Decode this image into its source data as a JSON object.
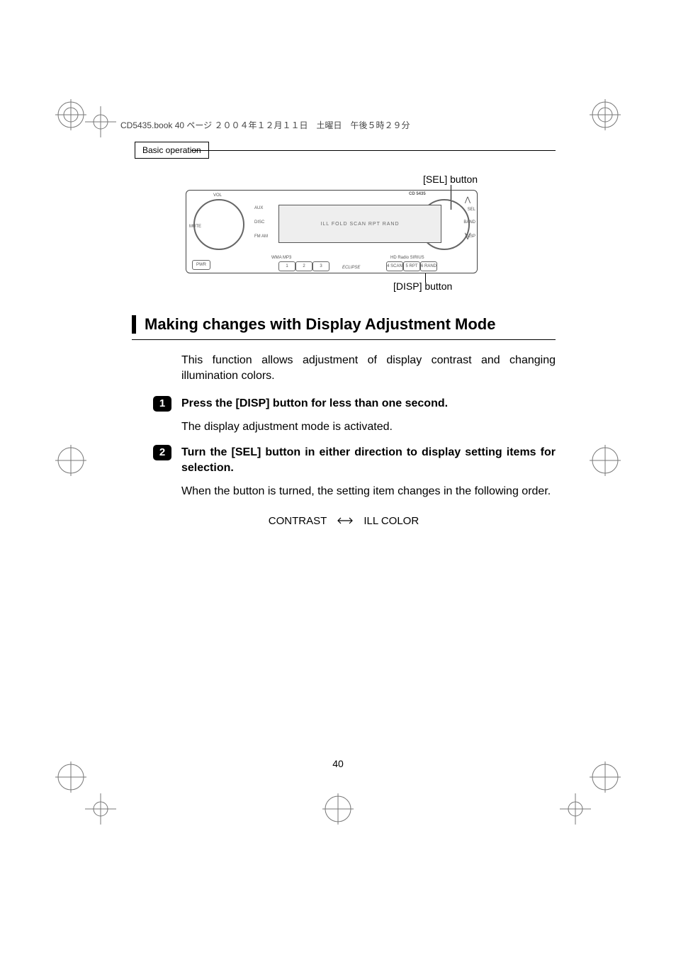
{
  "header": {
    "book_info": "CD5435.book  40 ページ  ２００４年１２月１１日　土曜日　午後５時２９分",
    "tab_label": "Basic operation"
  },
  "callouts": {
    "sel": "[SEL] button",
    "disp": "[DISP] button"
  },
  "device": {
    "model": "CD 5435",
    "vol": "VOL",
    "aux": "AUX",
    "disc": "DISC",
    "fm_am": "FM\nAM",
    "mute": "MUTE",
    "pwr": "PWR",
    "wma": "WMA MP3",
    "hd": "HD Radio  SIRIUS",
    "eclipse": "ECLIPSE",
    "sel": "SEL",
    "band": "BAND",
    "disp": "DISP",
    "display_text": "ILL FOLD SCAN RPT RAND",
    "btn1": "1",
    "btn2": "2",
    "btn3": "3",
    "btn4": "4 SCAN",
    "btn5": "5  RPT",
    "btn6": "6 RAND",
    "arrow_up": "⋀",
    "arrow_down": "⋁"
  },
  "section": {
    "heading": "Making changes with Display Adjustment Mode",
    "intro": "This function allows adjustment of display contrast and changing illumination colors.",
    "steps": [
      {
        "num": "1",
        "title": "Press the [DISP] button for less than one second.",
        "body": "The display adjustment mode is activated."
      },
      {
        "num": "2",
        "title": "Turn the [SEL] button in either direction to display setting items for selection.",
        "body": "When the button is turned, the setting item changes in the following order."
      }
    ],
    "order": {
      "left": "CONTRAST",
      "right": "ILL COLOR"
    }
  },
  "page_number": "40"
}
